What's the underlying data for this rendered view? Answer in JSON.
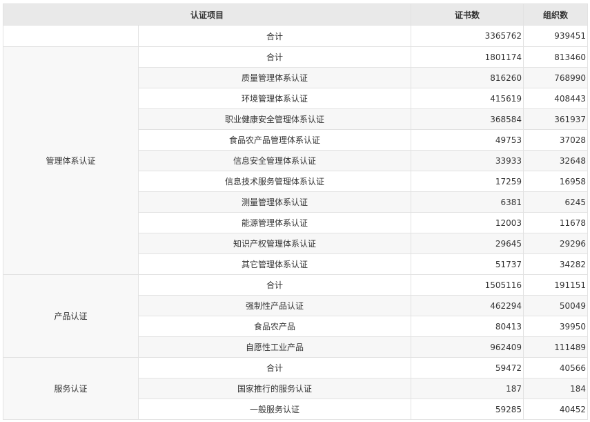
{
  "header": {
    "item": "认证项目",
    "certificates": "证书数",
    "organizations": "组织数"
  },
  "total": {
    "label": "合计",
    "certificates": "3365762",
    "organizations": "939451"
  },
  "groups": [
    {
      "name": "管理体系认证",
      "rows": [
        {
          "label": "合计",
          "certificates": "1801174",
          "organizations": "813460"
        },
        {
          "label": "质量管理体系认证",
          "certificates": "816260",
          "organizations": "768990"
        },
        {
          "label": "环境管理体系认证",
          "certificates": "415619",
          "organizations": "408443"
        },
        {
          "label": "职业健康安全管理体系认证",
          "certificates": "368584",
          "organizations": "361937"
        },
        {
          "label": "食品农产品管理体系认证",
          "certificates": "49753",
          "organizations": "37028"
        },
        {
          "label": "信息安全管理体系认证",
          "certificates": "33933",
          "organizations": "32648"
        },
        {
          "label": "信息技术服务管理体系认证",
          "certificates": "17259",
          "organizations": "16958"
        },
        {
          "label": "测量管理体系认证",
          "certificates": "6381",
          "organizations": "6245"
        },
        {
          "label": "能源管理体系认证",
          "certificates": "12003",
          "organizations": "11678"
        },
        {
          "label": "知识产权管理体系认证",
          "certificates": "29645",
          "organizations": "29296"
        },
        {
          "label": "其它管理体系认证",
          "certificates": "51737",
          "organizations": "34282"
        }
      ]
    },
    {
      "name": "产品认证",
      "rows": [
        {
          "label": "合计",
          "certificates": "1505116",
          "organizations": "191151"
        },
        {
          "label": "强制性产品认证",
          "certificates": "462294",
          "organizations": "50049"
        },
        {
          "label": "食品农产品",
          "certificates": "80413",
          "organizations": "39950"
        },
        {
          "label": "自愿性工业产品",
          "certificates": "962409",
          "organizations": "111489"
        }
      ]
    },
    {
      "name": "服务认证",
      "rows": [
        {
          "label": "合计",
          "certificates": "59472",
          "organizations": "40566"
        },
        {
          "label": "国家推行的服务认证",
          "certificates": "187",
          "organizations": "184"
        },
        {
          "label": "一般服务认证",
          "certificates": "59285",
          "organizations": "40452"
        }
      ]
    }
  ]
}
